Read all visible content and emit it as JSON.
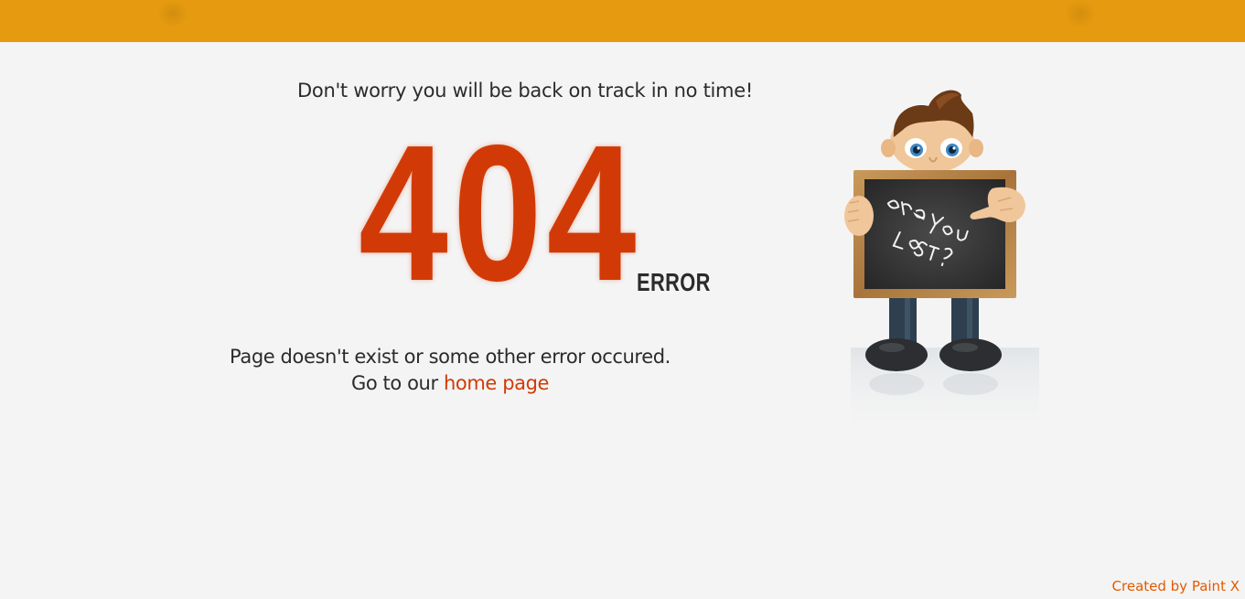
{
  "header": {
    "bar_color": "#e59a0f"
  },
  "main": {
    "tagline": "Don't worry you will be back on track in no time!",
    "code": "404",
    "error_label": "ERROR",
    "message_line1": "Page doesn't exist or some other error occured.",
    "message_prefix": "Go to our",
    "home_link": "home page",
    "accent_color": "#d13a06"
  },
  "illustration": {
    "name": "lost-boy-chalkboard",
    "board_text": "are you lost?"
  },
  "footer": {
    "credit": "Created by Paint X"
  }
}
